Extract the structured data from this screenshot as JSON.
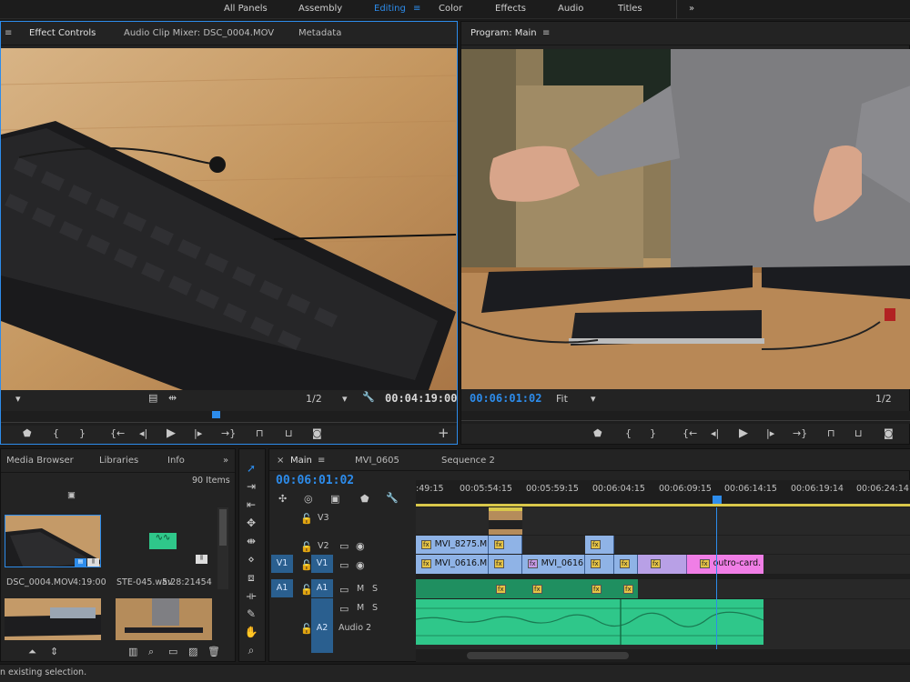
{
  "workspaces": [
    "All Panels",
    "Assembly",
    "Editing",
    "Color",
    "Effects",
    "Audio",
    "Titles"
  ],
  "workspace_active": "Editing",
  "more_icon": "»",
  "source_panel": {
    "tabs": [
      "Effect Controls",
      "Audio Clip Mixer: DSC_0004.MOV",
      "Metadata"
    ],
    "zoom": "1/2",
    "timecode": "00:04:19:00"
  },
  "program_panel": {
    "title": "Program: Main",
    "timecode": "00:06:01:02",
    "fit": "Fit",
    "zoom": "1/2"
  },
  "project_panel": {
    "tabs": [
      "Media Browser",
      "Libraries",
      "Info"
    ],
    "items_count": "90 Items",
    "items": [
      {
        "name": "DSC_0004.MOV",
        "duration": "4:19:00"
      },
      {
        "name": "STE-045.wav",
        "duration": "5:28:21454"
      }
    ]
  },
  "timeline": {
    "tabs": [
      "Main",
      "MVI_0605",
      "Sequence 2"
    ],
    "timecode": "00:06:01:02",
    "ruler": [
      ":49:15",
      "00:05:54:15",
      "00:05:59:15",
      "00:06:04:15",
      "00:06:09:15",
      "00:06:14:15",
      "00:06:19:14",
      "00:06:24:14"
    ],
    "tracks": {
      "v3": "V3",
      "v2": "V2",
      "v1": "V1",
      "a1": "A1",
      "a2": "A2",
      "audio2_name": "Audio 2",
      "m": "M",
      "s": "S"
    },
    "clips": {
      "v2_a": "MVI_8275.M",
      "v1_a": "MVI_0616.M",
      "v1_b": "MVI_0616",
      "v1_end": "outro-card."
    }
  },
  "status_bar": "n existing selection.",
  "colors": {
    "accent": "#2d8ceb",
    "clip_blue": "#8fb3e6",
    "clip_purple": "#b8a0e6",
    "clip_pink": "#f07ee6",
    "audio_green": "#2fc78a"
  }
}
